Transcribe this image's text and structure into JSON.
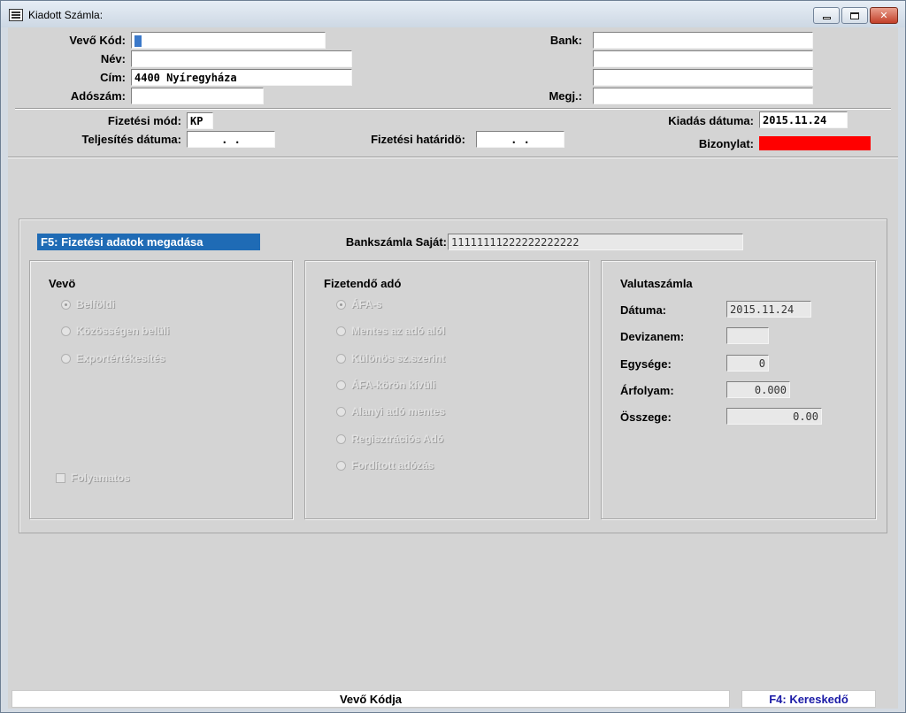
{
  "window": {
    "title": "Kiadott Számla:"
  },
  "header": {
    "vevo_kod": {
      "label": "Vevő  Kód:",
      "value": ""
    },
    "nev": {
      "label": "Név:",
      "value": ""
    },
    "cim": {
      "label": "Cím:",
      "value": "4400 Nyíregyháza"
    },
    "adoszam": {
      "label": "Adószám:",
      "value": ""
    },
    "bank": {
      "label": "Bank:",
      "value": ""
    },
    "bank2": {
      "value": ""
    },
    "bank3": {
      "value": ""
    },
    "megj": {
      "label": "Megj.:",
      "value": ""
    }
  },
  "payment": {
    "fizetesi_mod": {
      "label": "Fizetési mód:",
      "value": "KP"
    },
    "teljesites": {
      "label": "Teljesítés dátuma:",
      "value": ".  ."
    },
    "hatarido": {
      "label": "Fizetési határidö:",
      "value": ".  ."
    },
    "kiadas": {
      "label": "Kiadás dátuma:",
      "value": "2015.11.24"
    },
    "bizonylat": {
      "label": "Bizonylat:",
      "color": "#ff0000"
    }
  },
  "f5panel": {
    "title": "F5: Fizetési adatok megadása",
    "bankszamla_label": "Bankszámla Saját:",
    "bankszamla_value": "11111111222222222222",
    "vevo": {
      "title": "Vevö",
      "options": [
        "Belföldi",
        "Közösségen belüli",
        "Exportértékesítés"
      ],
      "selected": "Belföldi",
      "checkbox": "Folyamatos"
    },
    "ado": {
      "title": "Fizetendő adó",
      "options": [
        "ÁFA-s",
        "Mentes az adó alól",
        "Különös sz.szerint",
        "ÁFA-körön kívüli",
        "Alanyi adó mentes",
        "Regisztrációs Adó",
        "Fordított adózás"
      ],
      "selected": "ÁFA-s"
    },
    "valuta": {
      "title": "Valutaszámla",
      "datuma": {
        "label": "Dátuma:",
        "value": "2015.11.24"
      },
      "devizanem": {
        "label": "Devizanem:",
        "value": ""
      },
      "egysege": {
        "label": "Egysége:",
        "value": "0"
      },
      "arfolyam": {
        "label": "Árfolyam:",
        "value": "0.000"
      },
      "osszege": {
        "label": "Összege:",
        "value": "0.00"
      }
    }
  },
  "status": {
    "left": "Vevő Kódja",
    "right": "F4: Kereskedő"
  },
  "colors": {
    "highlight": "#1f6bb5",
    "status_right": "#1a1aa6"
  }
}
